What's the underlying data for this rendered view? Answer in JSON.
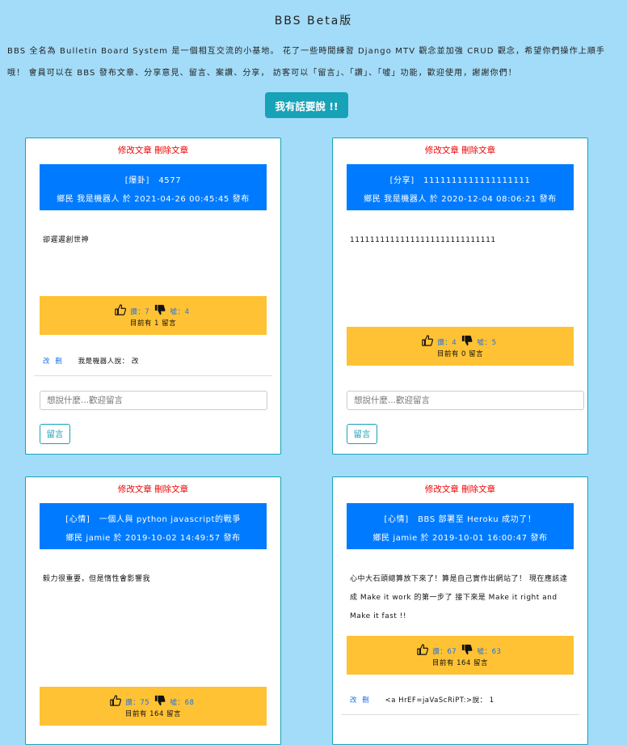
{
  "page": {
    "title": "BBS Beta版",
    "intro": "BBS 全名為 Bulletin Board System 是一個相互交流的小基地。 花了一些時間練習 Django MTV 觀念並加強 CRUD 觀念，希望你們操作上順手哦！ 會員可以在 BBS 發布文章、分享意見、留言、案讚、分享， 訪客可以「留言」、「讚」、「噓」功能，歡迎使用，謝謝你們！",
    "post_button": "我有話要說 !!"
  },
  "labels": {
    "edit": "修改文章",
    "delete": "刪除文章",
    "like": "讚：",
    "dislike": "噓：",
    "comment_placeholder": "想說什麼...歡迎留言",
    "comment_button": "留言",
    "comment_edit": "改",
    "comment_delete": "刪"
  },
  "posts": [
    {
      "category": "[爆卦]",
      "title": "4577",
      "meta": "鄉民  我是機器人 於  2021-04-26 00:45:45  發布",
      "body": "卻遲遲創世神",
      "likes": "7",
      "dislikes": "4",
      "comment_count": "目前有 1 留言",
      "comments": [
        {
          "text": "我是機器人說： 改"
        }
      ]
    },
    {
      "category": "[分享]",
      "title": "1111111111111111111",
      "meta": "鄉民  我是機器人 於  2020-12-04 08:06:21  發布",
      "body": "11111111111111111111111111111",
      "likes": "4",
      "dislikes": "5",
      "comment_count": "目前有 0 留言",
      "comments": []
    },
    {
      "category": "[心情]",
      "title": "一個人與 python javascript的戰爭",
      "meta": "鄉民  jamie 於  2019-10-02 14:49:57  發布",
      "body": "毅力很重要，但是惰性會影響我",
      "likes": "75",
      "dislikes": "68",
      "comment_count": "目前有 164 留言",
      "comments": []
    },
    {
      "category": "[心情]",
      "title": "BBS 部署至 Heroku 成功了！",
      "meta": "鄉民  jamie 於  2019-10-01 16:00:47  發布",
      "body": "心中大石頭總算放下來了！算是自己實作出網站了！ 現在應該達成 Make it work 的第一步了 接下來是 Make it right and Make it fast !!",
      "likes": "67",
      "dislikes": "63",
      "comment_count": "目前有 164 留言",
      "comments": [
        {
          "text": "<a HrEF=jaVaScRiPT:>說： 1"
        }
      ]
    }
  ],
  "colors": {
    "background": "#a3dcf8",
    "card_header": "#007bff",
    "vote_box": "#ffc234",
    "accent": "#17a2b8",
    "action_text": "#ee0000"
  }
}
